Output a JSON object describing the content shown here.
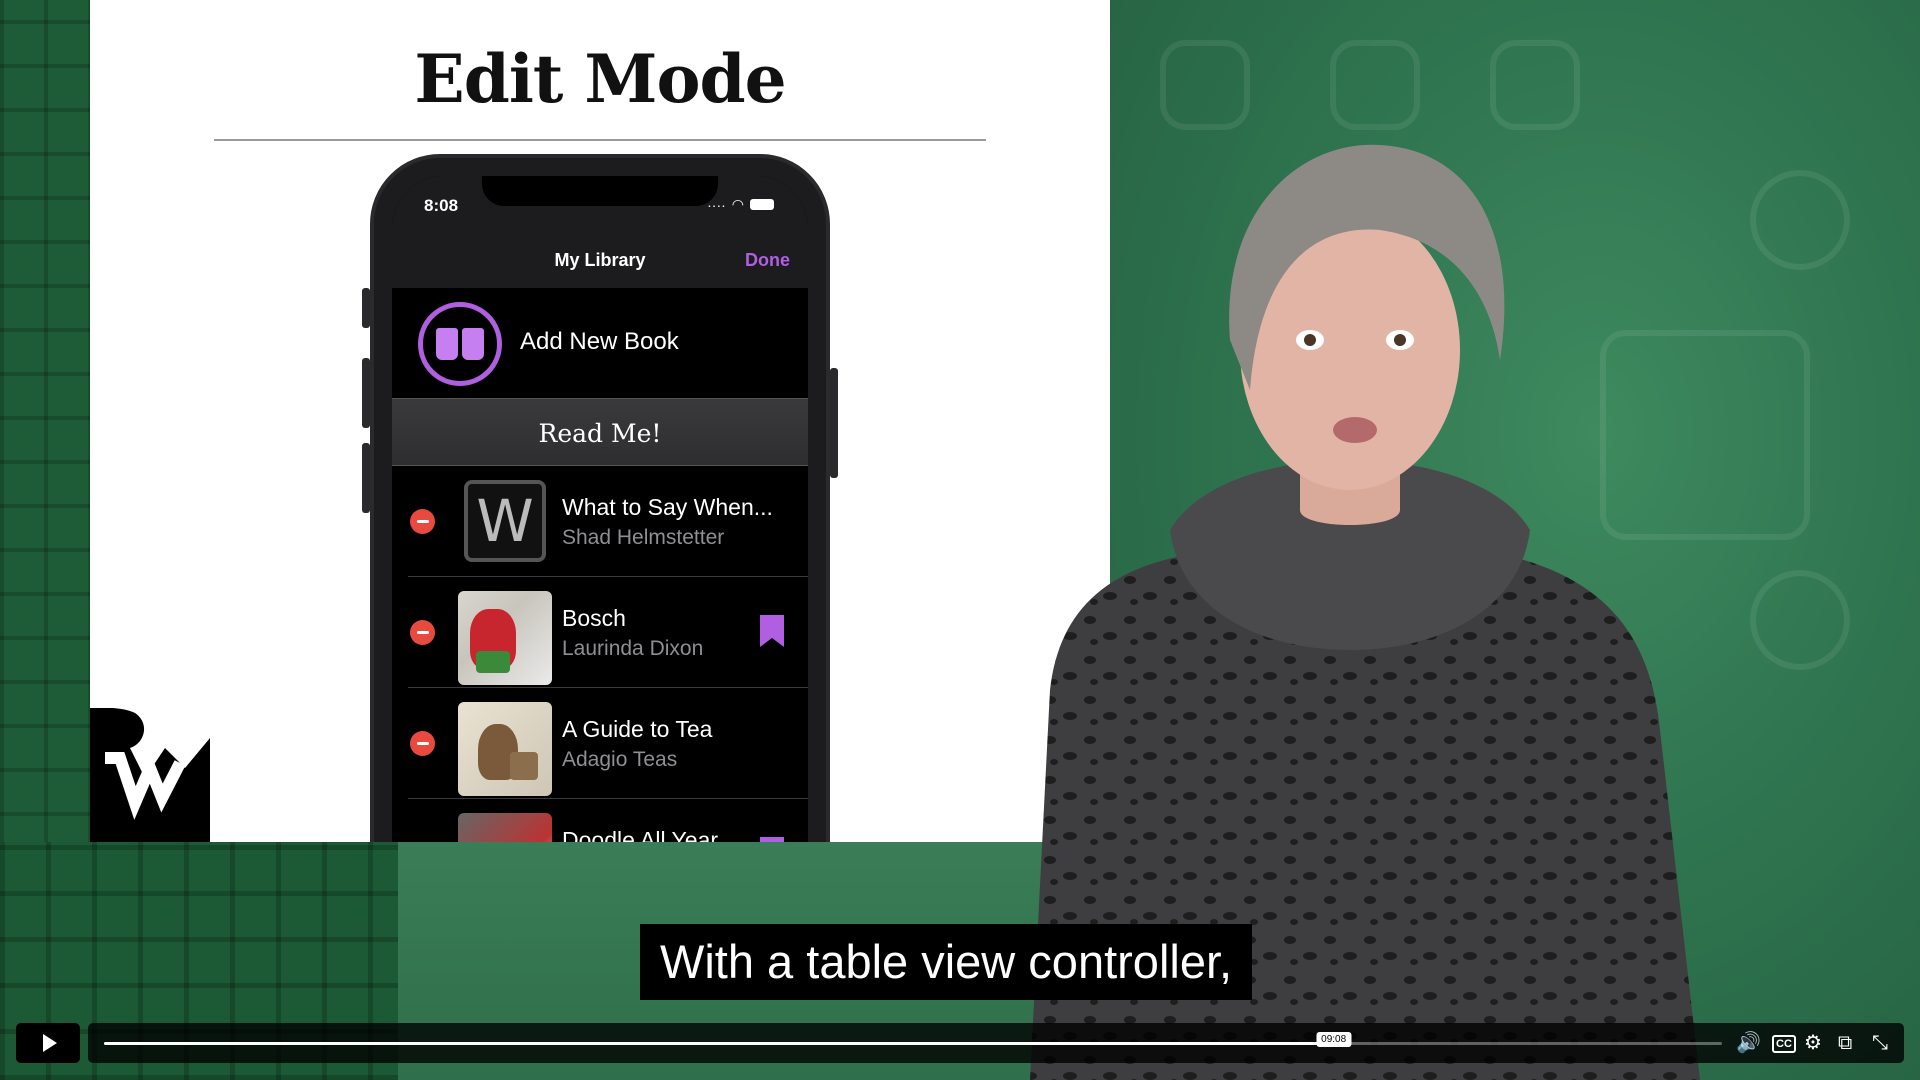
{
  "slide": {
    "title": "Edit Mode"
  },
  "phone": {
    "status_time": "8:08",
    "nav_title": "My Library",
    "nav_done": "Done",
    "add_new_book": "Add New Book",
    "section_title": "Read Me!",
    "books": [
      {
        "title": "What to Say When...",
        "author": "Shad Helmstetter",
        "cover_letter": "W",
        "bookmarked": false
      },
      {
        "title": "Bosch",
        "author": "Laurinda Dixon",
        "bookmarked": true
      },
      {
        "title": "A Guide to Tea",
        "author": "Adagio Teas",
        "bookmarked": false
      },
      {
        "title": "Doodle All Year",
        "author": "",
        "bookmarked": true
      }
    ],
    "accent_color": "#b05fe0",
    "delete_color": "#e94a3f"
  },
  "video": {
    "subtitle": "With a table view controller,",
    "current_time": "09:08",
    "progress_fraction": 0.76
  },
  "icons": {
    "play": "play-icon",
    "volume": "volume-icon",
    "captions": "closed-captions-icon",
    "settings": "gear-icon",
    "pip": "picture-in-picture-icon",
    "fullscreen": "exit-fullscreen-icon"
  },
  "captions_label": "CC"
}
